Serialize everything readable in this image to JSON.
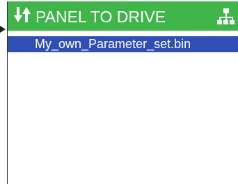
{
  "header": {
    "title": "PANEL TO DRIVE",
    "transfer_icon": "vertical-transfer-arrows-icon",
    "network_icon": "network-tree-icon"
  },
  "files": [
    {
      "name": "My_own_Parameter_set.bin",
      "selected": true
    }
  ],
  "colors": {
    "header_bg": "#3fb54a",
    "selection_bg": "#2f4fb5",
    "background": "#ffffff"
  }
}
